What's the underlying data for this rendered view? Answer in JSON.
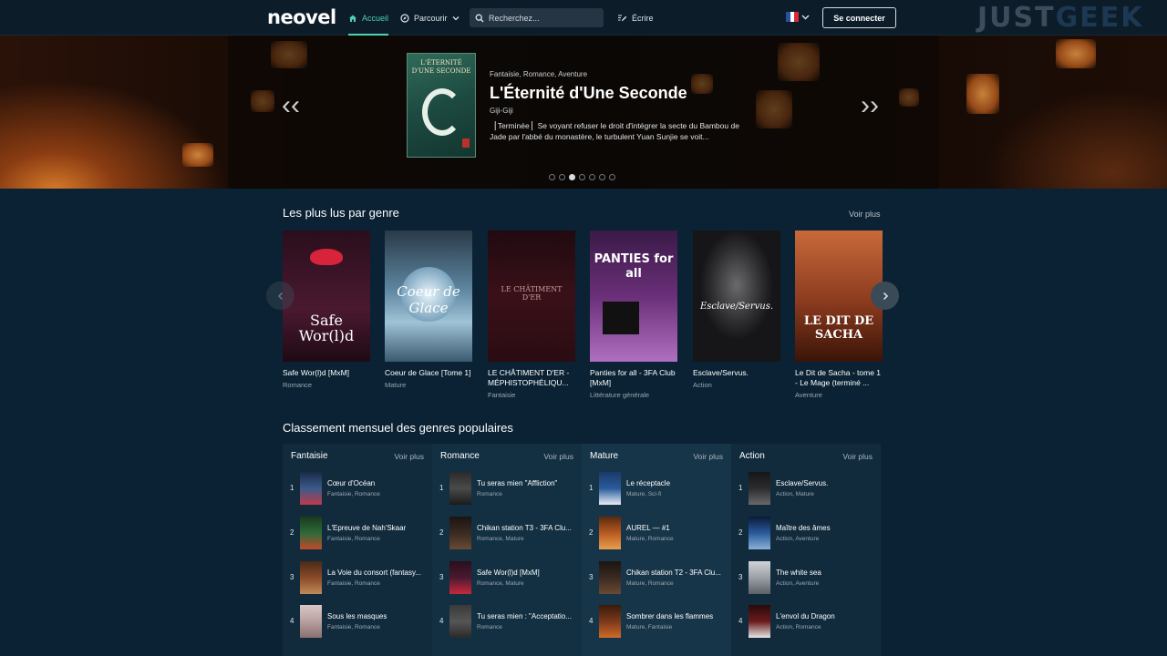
{
  "nav": {
    "logo": "neovel",
    "home": "Accueil",
    "browse": "Parcourir",
    "search_placeholder": "Recherchez...",
    "write": "Écrire",
    "login": "Se connecter",
    "watermark_1": "JUST",
    "watermark_2": "GEEK"
  },
  "hero": {
    "cover_title": "L'ÉTERNITÉ D'UNE SECONDE",
    "genres": "Fantaisie, Romance, Aventure",
    "title": "L'Éternité d'Une Seconde",
    "author": "Giji-Giji",
    "description": "▕ Terminée ▏Se voyant refuser le droit d'intégrer la secte du Bambou de Jade par l'abbé du monastère, le turbulent Yuan Sunjie se voit...",
    "prev": "‹‹",
    "next": "››"
  },
  "popular": {
    "title": "Les plus lus par genre",
    "see_more": "Voir plus",
    "books": [
      {
        "title": "Safe Wor(l)d [MxM]",
        "genre": "Romance",
        "cover": "Safe Wor(l)d",
        "bg": "#4a1930"
      },
      {
        "title": "Coeur de Glace [Tome 1]",
        "genre": "Mature",
        "cover": "Coeur de Glace",
        "bg": "#4b6a80"
      },
      {
        "title": "LE CHÂTIMENT D'ER - MÉPHISTOPHÉLIQU...",
        "genre": "Fantaisie",
        "cover": "LE CHÂTIMENT D'ER",
        "bg": "#3a1018"
      },
      {
        "title": "Panties for all - 3FA Club [MxM]",
        "genre": "Littérature générale",
        "cover": "PANTIES for all",
        "bg": "#6a2f78"
      },
      {
        "title": "Esclave/Servus.",
        "genre": "Action",
        "cover": "Esclave/Servus.",
        "bg": "#2c2c2e"
      },
      {
        "title": "Le Dit de Sacha - tome 1 - Le Mage (terminé ...",
        "genre": "Aventure",
        "cover": "LE DIT DE SACHA",
        "bg": "#8a3a1e"
      }
    ]
  },
  "ranking": {
    "title": "Classement mensuel des genres populaires",
    "columns": [
      {
        "genre": "Fantaisie",
        "see_more": "Voir plus",
        "items": [
          {
            "rank": "1",
            "title": "Cœur d'Océan",
            "genres": "Fantaisie, Romance",
            "thumb": "#3b5a8a"
          },
          {
            "rank": "2",
            "title": "L'Epreuve de Nah'Skaar",
            "genres": "Fantaisie, Romance",
            "thumb": "#2e6a3a"
          },
          {
            "rank": "3",
            "title": "La Voie du consort (fantasy...",
            "genres": "Fantaisie, Romance",
            "thumb": "#8a4a28"
          },
          {
            "rank": "4",
            "title": "Sous les masques",
            "genres": "Fantaisie, Romance",
            "thumb": "#b8a0a0"
          }
        ]
      },
      {
        "genre": "Romance",
        "see_more": "Voir plus",
        "items": [
          {
            "rank": "1",
            "title": "Tu seras mien \"Affliction\"",
            "genres": "Romance",
            "thumb": "#4a4a4a"
          },
          {
            "rank": "2",
            "title": "Chikan station T3 - 3FA Clu...",
            "genres": "Romance, Mature",
            "thumb": "#3a2a22"
          },
          {
            "rank": "3",
            "title": "Safe Wor(l)d [MxM]",
            "genres": "Romance, Mature",
            "thumb": "#4a1930"
          },
          {
            "rank": "4",
            "title": "Tu seras mien : \"Acceptatio...",
            "genres": "Romance",
            "thumb": "#555555"
          }
        ]
      },
      {
        "genre": "Mature",
        "see_more": "Voir plus",
        "items": [
          {
            "rank": "1",
            "title": "Le réceptacle",
            "genres": "Mature, Sci-fi",
            "thumb": "#2a5a9a"
          },
          {
            "rank": "2",
            "title": "AUREL — #1",
            "genres": "Mature, Romance",
            "thumb": "#b85a20"
          },
          {
            "rank": "3",
            "title": "Chikan station T2 - 3FA Clu...",
            "genres": "Mature, Romance",
            "thumb": "#3a2a22"
          },
          {
            "rank": "4",
            "title": "Sombrer dans les flammes",
            "genres": "Mature, Fantaisie",
            "thumb": "#7a3a1a"
          }
        ]
      },
      {
        "genre": "Action",
        "see_more": "Voir plus",
        "items": [
          {
            "rank": "1",
            "title": "Esclave/Servus.",
            "genres": "Action, Mature",
            "thumb": "#2c2c2e"
          },
          {
            "rank": "2",
            "title": "Maître des âmes",
            "genres": "Action, Aventure",
            "thumb": "#2a5a9a"
          },
          {
            "rank": "3",
            "title": "The white sea",
            "genres": "Action, Aventure",
            "thumb": "#9aa0a6"
          },
          {
            "rank": "4",
            "title": "L'envol du Dragon",
            "genres": "Action, Romance",
            "thumb": "#6a1a1a"
          }
        ]
      }
    ]
  }
}
